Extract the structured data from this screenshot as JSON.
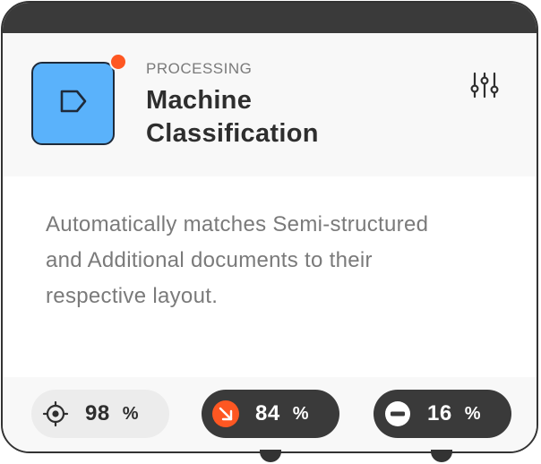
{
  "card": {
    "category": "PROCESSING",
    "title": "Machine Classification",
    "description": "Automatically matches Semi-structured and Additional documents to their respective layout.",
    "icons": {
      "app": "label-tag-icon",
      "settings": "sliders-icon"
    },
    "colors": {
      "app_icon_bg": "#5ab2fb",
      "status_dot": "#fe5722",
      "dark_pill": "#3a3a3a",
      "light_pill": "#ececec",
      "accent": "#fe5722"
    }
  },
  "stats": [
    {
      "icon": "crosshair-target-icon",
      "value": "98",
      "unit": "%"
    },
    {
      "icon": "arrow-down-right-icon",
      "value": "84",
      "unit": "%"
    },
    {
      "icon": "minus-circle-icon",
      "value": "16",
      "unit": "%"
    }
  ]
}
